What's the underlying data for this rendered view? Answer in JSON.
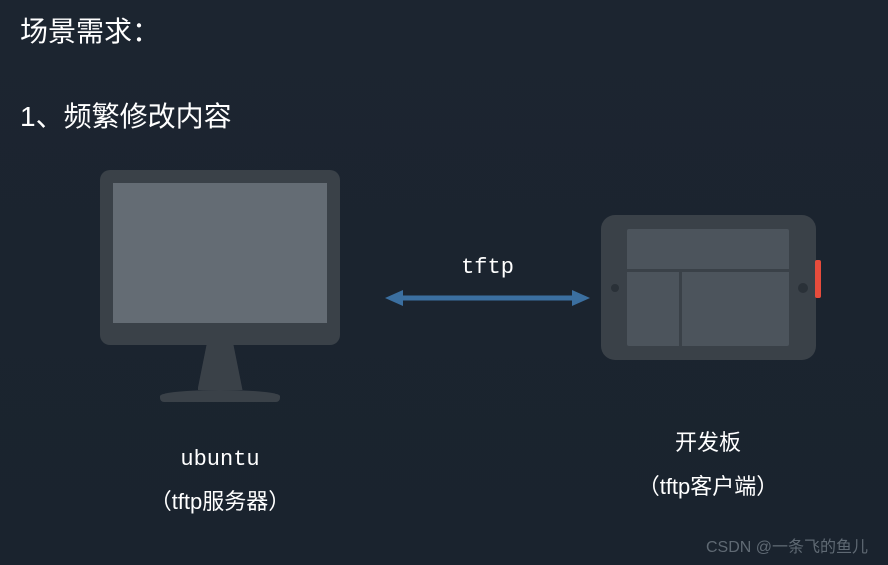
{
  "title": "场景需求：",
  "subtitle": "1、频繁修改内容",
  "left": {
    "name": "ubuntu",
    "role": "（tftp服务器）"
  },
  "right": {
    "name": "开发板",
    "role": "（tftp客户端）"
  },
  "connection": {
    "protocol": "tftp"
  },
  "watermark": "CSDN @一条飞的鱼儿",
  "colors": {
    "background": "#1c2530",
    "device_body": "#3a4148",
    "screen_fill": "#646c74",
    "arrow": "#3b6fa0",
    "accent_red": "#e74c3c"
  }
}
